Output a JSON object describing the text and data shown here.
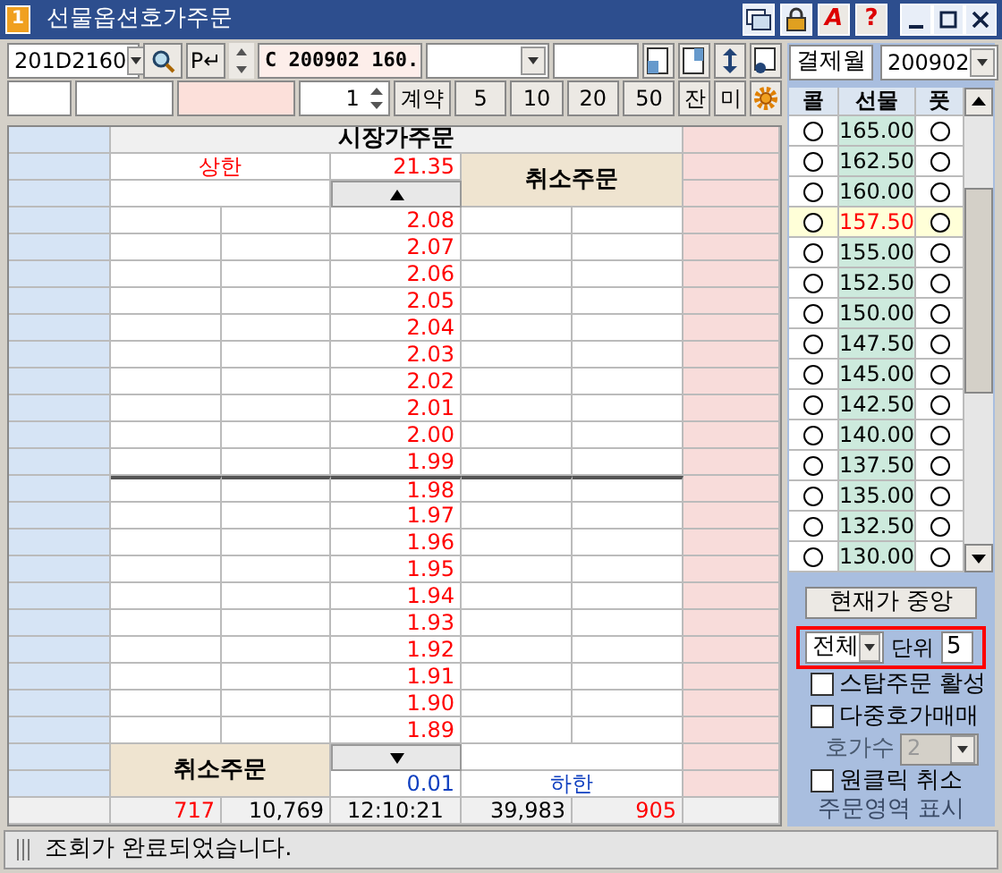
{
  "window": {
    "icon_text": "1",
    "title": "선물옵션호가주문",
    "tools": [
      "A",
      "?"
    ]
  },
  "toolbar": {
    "code": "201D2160",
    "enter_button": "P↵",
    "series": "C 200902 160.",
    "qty": "1",
    "qty_unit": "계약",
    "qty_buttons": [
      "5",
      "10",
      "20",
      "50"
    ],
    "buttons": [
      "잔",
      "미"
    ]
  },
  "order_book": {
    "header": "시장가주문",
    "upper_label": "상한",
    "upper_price": "21.35",
    "cancel_top": "취소주문",
    "prices": [
      "2.08",
      "2.07",
      "2.06",
      "2.05",
      "2.04",
      "2.03",
      "2.02",
      "2.01",
      "2.00",
      "1.99",
      "1.98",
      "1.97",
      "1.96",
      "1.95",
      "1.94",
      "1.93",
      "1.92",
      "1.91",
      "1.90",
      "1.89"
    ],
    "cancel_bottom": "취소주문",
    "tick": "0.01",
    "lower_label": "하한",
    "footer": [
      {
        "text": "717",
        "color": "#ff0000"
      },
      {
        "text": "10,769",
        "color": "#000000"
      },
      {
        "text": "12:10:21",
        "color": "#000000"
      },
      {
        "text": "39,983",
        "color": "#000000"
      },
      {
        "text": "905",
        "color": "#ff0000"
      }
    ]
  },
  "right_panel": {
    "month_label": "결제월",
    "month": "200902",
    "columns": [
      "콜",
      "선물",
      "풋"
    ],
    "strikes": [
      {
        "price": "165.00",
        "selected": false,
        "call_checked": false,
        "put_checked": false
      },
      {
        "price": "162.50",
        "selected": false,
        "call_checked": false,
        "put_checked": false
      },
      {
        "price": "160.00",
        "selected": false,
        "call_checked": false,
        "put_checked": false
      },
      {
        "price": "157.50",
        "selected": true,
        "call_checked": false,
        "put_checked": false
      },
      {
        "price": "155.00",
        "selected": false,
        "call_checked": false,
        "put_checked": false
      },
      {
        "price": "152.50",
        "selected": false,
        "call_checked": false,
        "put_checked": false
      },
      {
        "price": "150.00",
        "selected": false,
        "call_checked": false,
        "put_checked": false
      },
      {
        "price": "147.50",
        "selected": false,
        "call_checked": false,
        "put_checked": false
      },
      {
        "price": "145.00",
        "selected": false,
        "call_checked": false,
        "put_checked": false
      },
      {
        "price": "142.50",
        "selected": false,
        "call_checked": false,
        "put_checked": false
      },
      {
        "price": "140.00",
        "selected": false,
        "call_checked": false,
        "put_checked": false
      },
      {
        "price": "137.50",
        "selected": false,
        "call_checked": false,
        "put_checked": false
      },
      {
        "price": "135.00",
        "selected": false,
        "call_checked": false,
        "put_checked": false
      },
      {
        "price": "132.50",
        "selected": false,
        "call_checked": false,
        "put_checked": false
      },
      {
        "price": "130.00",
        "selected": false,
        "call_checked": false,
        "put_checked": false
      }
    ],
    "center_button": "현재가 중앙",
    "range": "전체",
    "unit_label": "단위",
    "unit": "5",
    "highlighted": true,
    "options": [
      {
        "label": "스탑주문 활성",
        "checked": false
      },
      {
        "label": "다중호가매매",
        "checked": false
      }
    ],
    "depth_label": "호가수",
    "depth": "2",
    "depth_disabled": true,
    "oneclick": {
      "label": "원클릭 취소",
      "checked": false
    },
    "area_label": "주문영역 표시"
  },
  "status_bar": "조회가 완료되었습니다."
}
